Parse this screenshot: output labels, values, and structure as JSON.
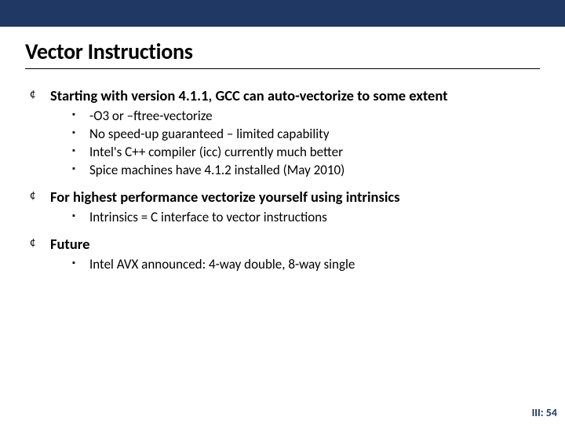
{
  "title": "Vector Instructions",
  "points": [
    {
      "text": "Starting with version 4.1.1, GCC can auto-vectorize to some extent",
      "subs": [
        "-O3 or –ftree-vectorize",
        "No speed-up guaranteed – limited capability",
        "Intel's C++ compiler (icc) currently much better",
        "Spice machines have 4.1.2 installed (May 2010)"
      ]
    },
    {
      "text": "For highest performance vectorize yourself using intrinsics",
      "subs": [
        "Intrinsics = C interface to vector instructions"
      ]
    },
    {
      "text": "Future",
      "subs": [
        "Intel AVX announced: 4-way double, 8-way single"
      ]
    }
  ],
  "footer": "III: 54"
}
